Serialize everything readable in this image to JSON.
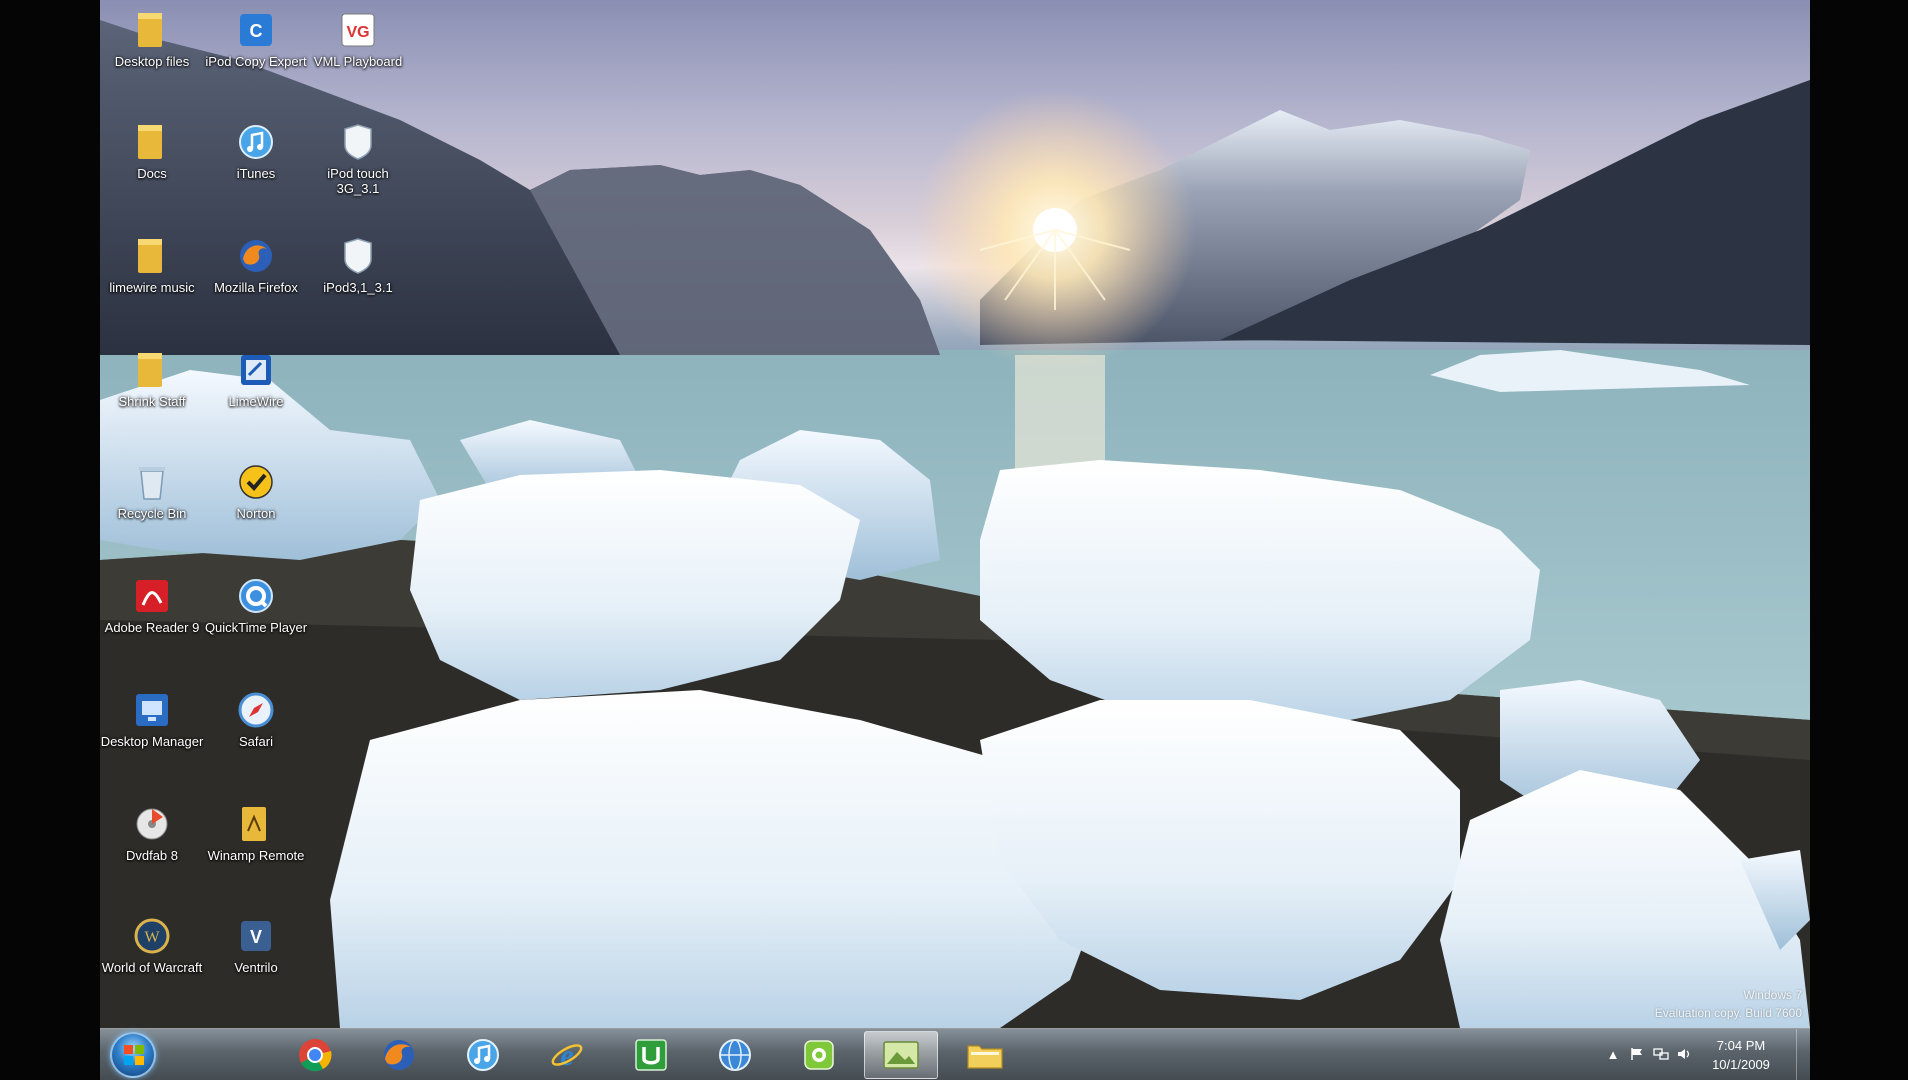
{
  "desktop": {
    "icons": [
      {
        "name": "folder-icon",
        "label": "Desktop files"
      },
      {
        "name": "ipod-copy-expert-icon",
        "label": "iPod Copy Expert"
      },
      {
        "name": "vlc-player-icon",
        "label": "VML Playboard"
      },
      {
        "name": "folder-icon",
        "label": "Docs"
      },
      {
        "name": "itunes-icon",
        "label": "iTunes"
      },
      {
        "name": "ipod-touch-icon",
        "label": "iPod touch 3G_3.1"
      },
      {
        "name": "folder-icon",
        "label": "limewire music"
      },
      {
        "name": "firefox-icon",
        "label": "Mozilla Firefox"
      },
      {
        "name": "ipod-firmware-icon",
        "label": "iPod3,1_3.1"
      },
      {
        "name": "folder-icon",
        "label": "Shrink Staff"
      },
      {
        "name": "shortcut-icon",
        "label": "LimeWire"
      },
      {
        "name": "recycle-bin-icon",
        "label": "Recycle Bin"
      },
      {
        "name": "norton-icon",
        "label": "Norton"
      },
      {
        "name": "adobe-reader-icon",
        "label": "Adobe Reader 9"
      },
      {
        "name": "quicktime-icon",
        "label": "QuickTime Player"
      },
      {
        "name": "desktop-manager-icon",
        "label": "Desktop Manager"
      },
      {
        "name": "safari-icon",
        "label": "Safari"
      },
      {
        "name": "dvd-icon",
        "label": "Dvdfab 8"
      },
      {
        "name": "winamp-icon",
        "label": "Winamp Remote"
      },
      {
        "name": "world-of-warcraft-icon",
        "label": "World of Warcraft"
      },
      {
        "name": "ventrilo-icon",
        "label": "Ventrilo"
      }
    ],
    "watermark": {
      "line1": "Windows 7",
      "line2": "Evaluation copy. Build 7600"
    }
  },
  "taskbar": {
    "start_label": "Start",
    "pinned": [
      {
        "name": "chrome-icon"
      },
      {
        "name": "firefox-icon"
      },
      {
        "name": "itunes-icon"
      },
      {
        "name": "internet-explorer-icon"
      },
      {
        "name": "utorrent-icon"
      },
      {
        "name": "globe-icon"
      },
      {
        "name": "green-app-icon"
      },
      {
        "name": "image-viewer-icon"
      },
      {
        "name": "folder-icon"
      }
    ],
    "tray": {
      "time": "7:04 PM",
      "date": "10/1/2009"
    }
  }
}
